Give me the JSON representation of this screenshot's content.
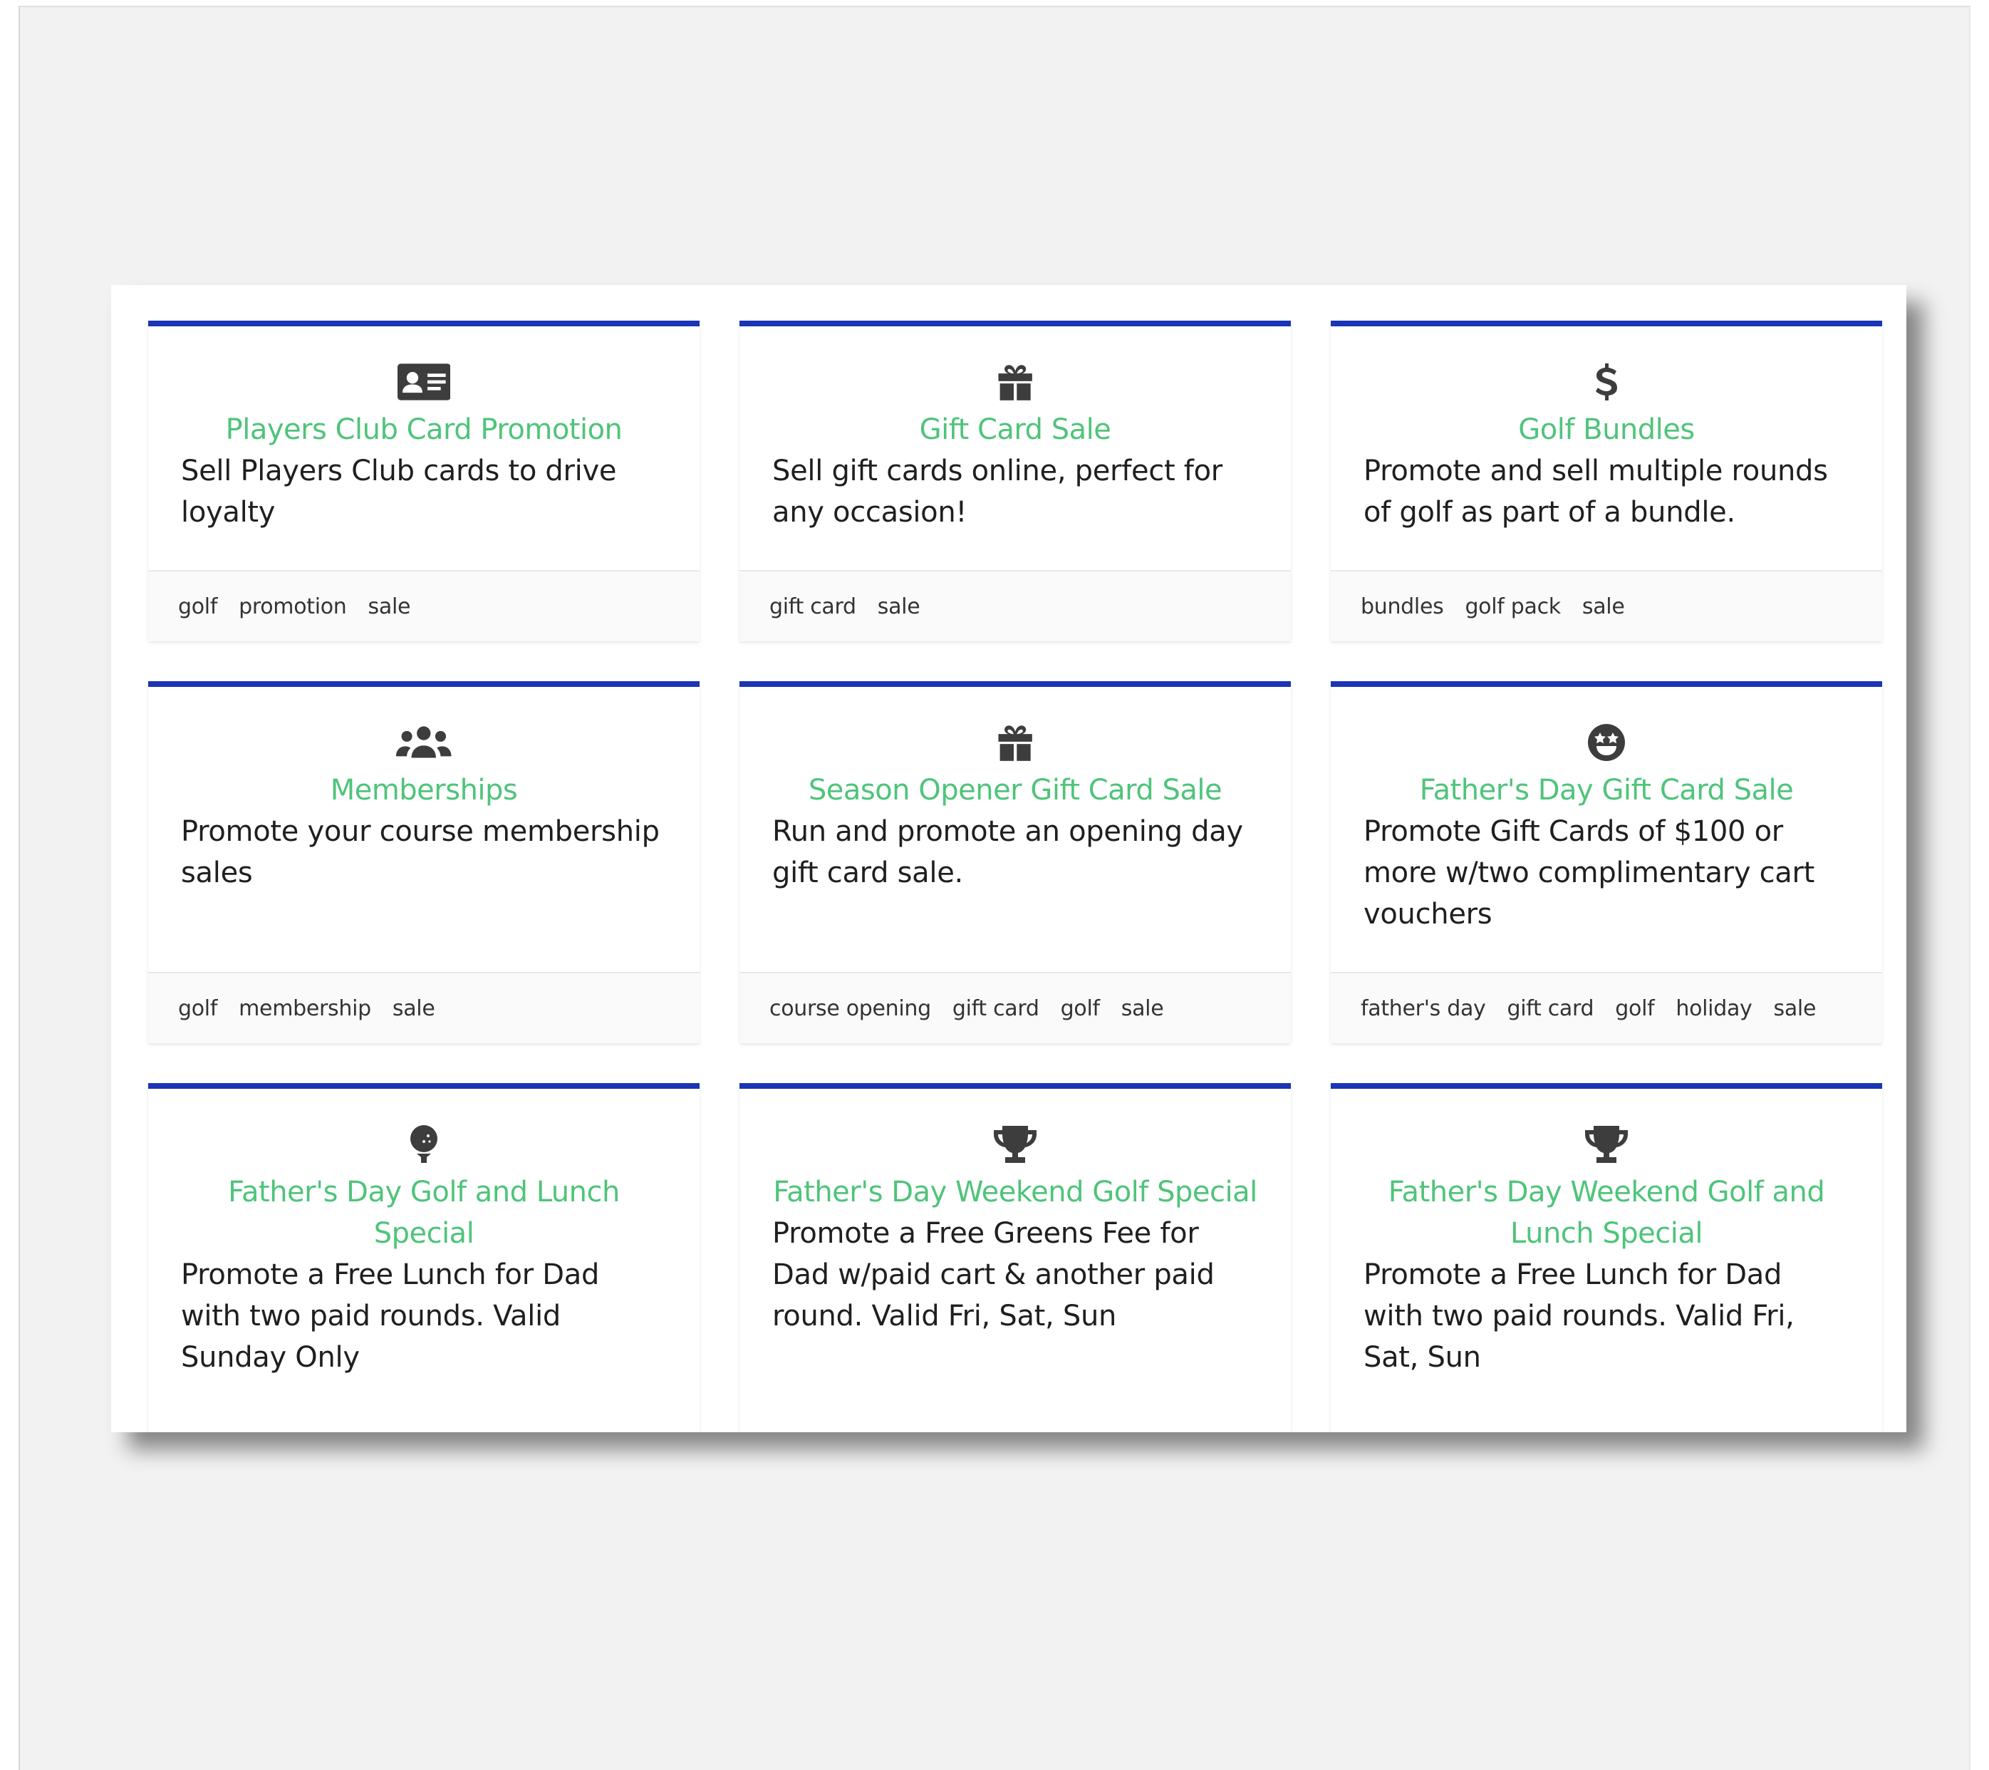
{
  "cards": [
    {
      "icon": "id-card-icon",
      "title": "Players Club Card Promotion",
      "description": "Sell Players Club cards to drive loyalty",
      "tags": [
        "golf",
        "promotion",
        "sale"
      ]
    },
    {
      "icon": "gift-icon",
      "title": "Gift Card Sale",
      "description": "Sell gift cards online, perfect for any occasion!",
      "tags": [
        "gift card",
        "sale"
      ]
    },
    {
      "icon": "dollar-sign-icon",
      "title": "Golf Bundles",
      "description": "Promote and sell multiple rounds of golf as part of a bundle.",
      "tags": [
        "bundles",
        "golf pack",
        "sale"
      ]
    },
    {
      "icon": "users-icon",
      "title": "Memberships",
      "description": "Promote your course membership sales",
      "tags": [
        "golf",
        "membership",
        "sale"
      ]
    },
    {
      "icon": "gift-icon",
      "title": "Season Opener Gift Card Sale",
      "description": "Run and promote an opening day gift card sale.",
      "tags": [
        "course opening",
        "gift card",
        "golf",
        "sale"
      ]
    },
    {
      "icon": "star-eyes-face-icon",
      "title": "Father's Day Gift Card Sale",
      "description": "Promote Gift Cards of $100 or more w/two complimentary cart vouchers",
      "tags": [
        "father's day",
        "gift card",
        "golf",
        "holiday",
        "sale"
      ]
    },
    {
      "icon": "golf-ball-tee-icon",
      "title": "Father's Day Golf and Lunch Special",
      "description": "Promote a Free Lunch for Dad with two paid rounds. Valid Sunday Only",
      "tags": []
    },
    {
      "icon": "trophy-icon",
      "title": "Father's Day Weekend Golf Special",
      "description": "Promote a Free Greens Fee for Dad w/paid cart & another paid round. Valid Fri, Sat, Sun",
      "tags": []
    },
    {
      "icon": "trophy-icon",
      "title": "Father's Day Weekend Golf and Lunch Special",
      "description": "Promote a Free Lunch for Dad with two paid rounds. Valid Fri, Sat, Sun",
      "tags": []
    }
  ],
  "colors": {
    "accent_bar": "#1a35b5",
    "title_green": "#4fc47a",
    "icon_gray": "#3d3d3d"
  }
}
